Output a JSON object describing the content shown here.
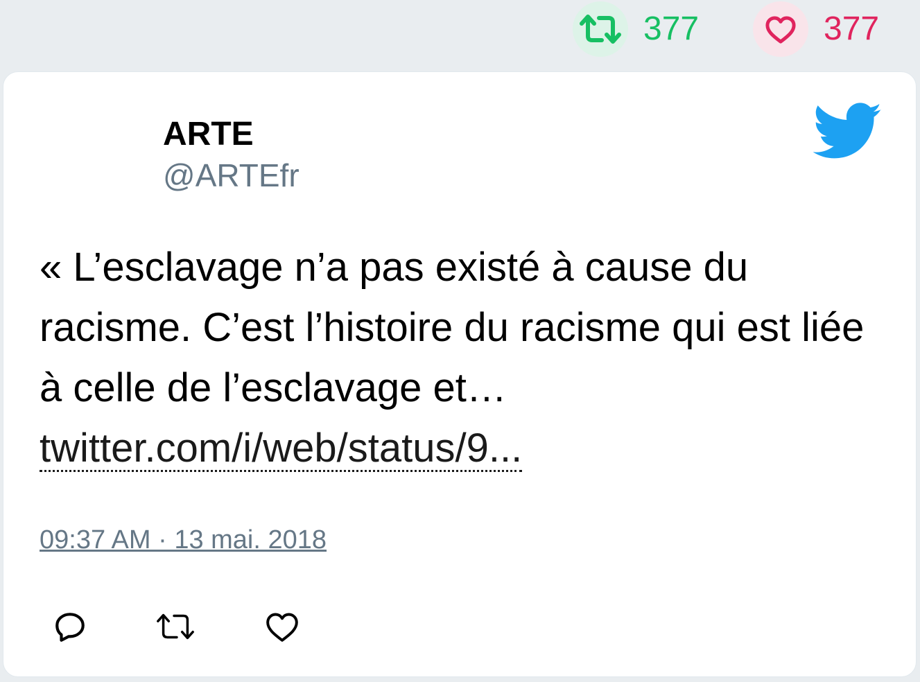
{
  "top_stats": {
    "retweet_count": "377",
    "like_count": "377"
  },
  "tweet": {
    "author_name": "ARTE",
    "author_handle": "@ARTEfr",
    "text": "« L’esclavage n’a pas existé à cause du racisme. C’est l’histoire du racisme qui est liée à celle de l’esclavage et…",
    "link_text": "twitter.com/i/web/status/9...",
    "timestamp": "09:37 AM · 13 mai. 2018"
  },
  "icons": {
    "retweet": "retweet-icon",
    "like": "heart-icon",
    "reply": "reply-icon",
    "logo": "twitter-bird-icon"
  },
  "colors": {
    "retweet": "#17bf63",
    "like": "#e0245e",
    "brand": "#1da1f2",
    "secondary_text": "#657786"
  }
}
